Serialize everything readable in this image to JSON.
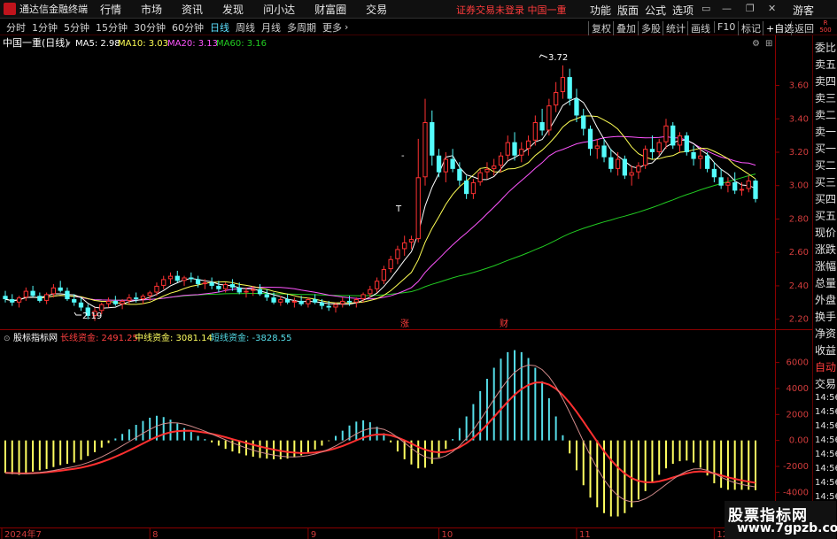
{
  "menubar": {
    "app_title": "通达信金融终端",
    "items": [
      "行情",
      "市场",
      "资讯",
      "发现",
      "问小达",
      "财富圈",
      "交易"
    ],
    "status": "证券交易未登录  中国一重",
    "right_items": [
      "功能",
      "版面",
      "公式",
      "选项"
    ],
    "guest": "游客"
  },
  "tabbar": {
    "tabs": [
      "分时",
      "1分钟",
      "5分钟",
      "15分钟",
      "30分钟",
      "60分钟",
      "日线",
      "周线",
      "月线",
      "多周期",
      "更多"
    ],
    "active": "日线",
    "right_tabs": [
      "复权",
      "叠加",
      "多股",
      "统计",
      "画线",
      "F10",
      "标记",
      "+自选",
      "返回"
    ]
  },
  "sidepanel": {
    "r_label": "R",
    "r_code": "500",
    "labels": [
      "委比",
      "卖五",
      "卖四",
      "卖三",
      "卖二",
      "卖一",
      "买一",
      "买二",
      "买三",
      "买四",
      "买五",
      "现价",
      "涨跌",
      "涨幅",
      "总量",
      "外盘",
      "换手",
      "净资",
      "收益"
    ],
    "auto": "自动",
    "trade": "交易",
    "times": [
      "14:56",
      "14:56",
      "14:56",
      "14:56",
      "14:56",
      "14:56",
      "14:56",
      "14:56"
    ]
  },
  "main_panel": {
    "title": "中国一重(日线)",
    "ma_legend": [
      {
        "label": "MA5: 2.98",
        "color": "#ffffff"
      },
      {
        "label": "MA10: 3.03",
        "color": "#ffff55"
      },
      {
        "label": "MA20: 3.13",
        "color": "#ff55ff"
      },
      {
        "label": "MA60: 3.16",
        "color": "#22cc22"
      }
    ],
    "high_label": "3.72",
    "low_label": "2.19",
    "t_mark": "T",
    "dash_mark": "-",
    "event_marks": [
      "涨",
      "财"
    ],
    "price_ticks": [
      "3.60",
      "3.40",
      "3.20",
      "3.00",
      "2.80",
      "2.60",
      "2.40",
      "2.20"
    ]
  },
  "indicator_panel": {
    "title": "股标指标网",
    "legend": [
      {
        "label": "长线资金: 2491.25",
        "color": "#ff4040"
      },
      {
        "label": "中线资金: 3081.14",
        "color": "#ffff60"
      },
      {
        "label": "短线资金: -3828.55",
        "color": "#55dde8"
      }
    ],
    "ticks": [
      "6000",
      "4000",
      "2000",
      "0.00",
      "-2000",
      "-4000"
    ]
  },
  "date_axis": [
    "2024年7",
    "8",
    "9",
    "10",
    "11",
    "12"
  ],
  "watermark": {
    "line1": "股票指标网",
    "line2": "www.7gpzb.com"
  },
  "colors": {
    "up": "#ff3232",
    "down": "#54fcfc",
    "ma5": "#ffffff",
    "ma10": "#ffff55",
    "ma20": "#ff55ff",
    "ma60": "#22cc22",
    "long_fund": "#ff3030",
    "mid_fund": "#ffff60",
    "short_fund": "#55dde8"
  },
  "chart_data": {
    "type": "candlestick",
    "title": "中国一重(日线)",
    "y_range": [
      2.14,
      3.82
    ],
    "indicator_range": [
      -6500,
      7200
    ],
    "candles": [
      [
        2.34,
        2.37,
        2.3,
        2.32
      ],
      [
        2.32,
        2.35,
        2.28,
        2.3
      ],
      [
        2.3,
        2.34,
        2.27,
        2.33
      ],
      [
        2.33,
        2.39,
        2.31,
        2.37
      ],
      [
        2.37,
        2.4,
        2.33,
        2.34
      ],
      [
        2.34,
        2.36,
        2.3,
        2.31
      ],
      [
        2.31,
        2.36,
        2.29,
        2.35
      ],
      [
        2.35,
        2.41,
        2.33,
        2.39
      ],
      [
        2.39,
        2.43,
        2.36,
        2.37
      ],
      [
        2.37,
        2.39,
        2.31,
        2.32
      ],
      [
        2.32,
        2.35,
        2.28,
        2.3
      ],
      [
        2.3,
        2.33,
        2.25,
        2.27
      ],
      [
        2.27,
        2.29,
        2.2,
        2.22
      ],
      [
        2.22,
        2.27,
        2.19,
        2.25
      ],
      [
        2.25,
        2.3,
        2.23,
        2.29
      ],
      [
        2.29,
        2.33,
        2.27,
        2.31
      ],
      [
        2.31,
        2.34,
        2.28,
        2.29
      ],
      [
        2.29,
        2.32,
        2.26,
        2.31
      ],
      [
        2.31,
        2.35,
        2.29,
        2.33
      ],
      [
        2.33,
        2.36,
        2.3,
        2.32
      ],
      [
        2.32,
        2.35,
        2.29,
        2.34
      ],
      [
        2.34,
        2.37,
        2.31,
        2.36
      ],
      [
        2.36,
        2.42,
        2.34,
        2.4
      ],
      [
        2.4,
        2.46,
        2.38,
        2.44
      ],
      [
        2.44,
        2.48,
        2.41,
        2.46
      ],
      [
        2.46,
        2.49,
        2.42,
        2.43
      ],
      [
        2.43,
        2.46,
        2.4,
        2.45
      ],
      [
        2.45,
        2.48,
        2.42,
        2.44
      ],
      [
        2.44,
        2.46,
        2.39,
        2.41
      ],
      [
        2.41,
        2.44,
        2.38,
        2.42
      ],
      [
        2.42,
        2.45,
        2.38,
        2.4
      ],
      [
        2.4,
        2.43,
        2.36,
        2.38
      ],
      [
        2.38,
        2.42,
        2.36,
        2.41
      ],
      [
        2.41,
        2.44,
        2.37,
        2.39
      ],
      [
        2.39,
        2.42,
        2.35,
        2.36
      ],
      [
        2.36,
        2.39,
        2.33,
        2.37
      ],
      [
        2.37,
        2.4,
        2.34,
        2.38
      ],
      [
        2.38,
        2.41,
        2.34,
        2.35
      ],
      [
        2.35,
        2.38,
        2.31,
        2.33
      ],
      [
        2.33,
        2.36,
        2.29,
        2.3
      ],
      [
        2.3,
        2.34,
        2.28,
        2.32
      ],
      [
        2.32,
        2.35,
        2.29,
        2.3
      ],
      [
        2.3,
        2.33,
        2.27,
        2.31
      ],
      [
        2.31,
        2.34,
        2.28,
        2.29
      ],
      [
        2.29,
        2.33,
        2.27,
        2.32
      ],
      [
        2.32,
        2.35,
        2.29,
        2.3
      ],
      [
        2.3,
        2.32,
        2.26,
        2.28
      ],
      [
        2.28,
        2.31,
        2.25,
        2.27
      ],
      [
        2.27,
        2.3,
        2.24,
        2.29
      ],
      [
        2.29,
        2.33,
        2.27,
        2.31
      ],
      [
        2.31,
        2.34,
        2.28,
        2.3
      ],
      [
        2.3,
        2.33,
        2.27,
        2.32
      ],
      [
        2.32,
        2.36,
        2.3,
        2.35
      ],
      [
        2.35,
        2.4,
        2.33,
        2.38
      ],
      [
        2.38,
        2.45,
        2.36,
        2.43
      ],
      [
        2.43,
        2.52,
        2.41,
        2.5
      ],
      [
        2.5,
        2.58,
        2.48,
        2.56
      ],
      [
        2.56,
        2.64,
        2.53,
        2.62
      ],
      [
        2.62,
        2.7,
        2.58,
        2.66
      ],
      [
        2.66,
        2.7,
        2.62,
        2.68
      ],
      [
        2.68,
        3.28,
        2.66,
        3.05
      ],
      [
        3.05,
        3.52,
        3.0,
        3.38
      ],
      [
        3.38,
        3.45,
        3.12,
        3.18
      ],
      [
        3.18,
        3.22,
        3.05,
        3.08
      ],
      [
        3.08,
        3.2,
        3.02,
        3.16
      ],
      [
        3.16,
        3.22,
        3.08,
        3.1
      ],
      [
        3.1,
        3.14,
        3.0,
        3.03
      ],
      [
        3.03,
        3.06,
        2.92,
        2.95
      ],
      [
        2.95,
        3.04,
        2.92,
        3.02
      ],
      [
        3.02,
        3.1,
        3.0,
        3.08
      ],
      [
        3.08,
        3.14,
        3.04,
        3.1
      ],
      [
        3.1,
        3.16,
        3.06,
        3.12
      ],
      [
        3.12,
        3.2,
        3.08,
        3.18
      ],
      [
        3.18,
        3.3,
        3.15,
        3.26
      ],
      [
        3.26,
        3.32,
        3.15,
        3.18
      ],
      [
        3.18,
        3.26,
        3.14,
        3.22
      ],
      [
        3.22,
        3.3,
        3.18,
        3.27
      ],
      [
        3.27,
        3.42,
        3.24,
        3.38
      ],
      [
        3.38,
        3.46,
        3.3,
        3.33
      ],
      [
        3.33,
        3.52,
        3.3,
        3.48
      ],
      [
        3.48,
        3.62,
        3.44,
        3.56
      ],
      [
        3.56,
        3.72,
        3.52,
        3.65
      ],
      [
        3.65,
        3.7,
        3.48,
        3.52
      ],
      [
        3.52,
        3.58,
        3.38,
        3.42
      ],
      [
        3.42,
        3.46,
        3.3,
        3.34
      ],
      [
        3.34,
        3.36,
        3.18,
        3.22
      ],
      [
        3.22,
        3.28,
        3.16,
        3.24
      ],
      [
        3.24,
        3.28,
        3.14,
        3.17
      ],
      [
        3.17,
        3.22,
        3.08,
        3.1
      ],
      [
        3.1,
        3.2,
        3.06,
        3.16
      ],
      [
        3.16,
        3.18,
        3.04,
        3.06
      ],
      [
        3.06,
        3.12,
        3.0,
        3.08
      ],
      [
        3.08,
        3.14,
        3.04,
        3.12
      ],
      [
        3.12,
        3.24,
        3.1,
        3.22
      ],
      [
        3.22,
        3.3,
        3.16,
        3.2
      ],
      [
        3.2,
        3.28,
        3.18,
        3.26
      ],
      [
        3.26,
        3.4,
        3.22,
        3.36
      ],
      [
        3.36,
        3.38,
        3.22,
        3.24
      ],
      [
        3.24,
        3.32,
        3.2,
        3.3
      ],
      [
        3.3,
        3.32,
        3.18,
        3.2
      ],
      [
        3.2,
        3.24,
        3.12,
        3.16
      ],
      [
        3.16,
        3.22,
        3.1,
        3.18
      ],
      [
        3.18,
        3.2,
        3.08,
        3.1
      ],
      [
        3.1,
        3.14,
        3.02,
        3.05
      ],
      [
        3.05,
        3.1,
        2.98,
        3.0
      ],
      [
        3.0,
        3.05,
        2.96,
        3.02
      ],
      [
        3.02,
        3.08,
        2.95,
        2.97
      ],
      [
        2.97,
        3.02,
        2.94,
        2.98
      ],
      [
        2.98,
        3.06,
        2.96,
        3.03
      ],
      [
        3.03,
        3.04,
        2.9,
        2.92
      ]
    ],
    "indicator": [
      -2500,
      -2600,
      -2650,
      -2600,
      -2400,
      -2300,
      -2200,
      -2050,
      -1900,
      -1800,
      -1700,
      -1500,
      -1200,
      -900,
      -550,
      -200,
      150,
      500,
      850,
      1200,
      1500,
      1750,
      1900,
      1800,
      1600,
      1300,
      950,
      650,
      350,
      100,
      -150,
      -400,
      -650,
      -850,
      -1000,
      -1150,
      -1250,
      -1350,
      -1400,
      -1450,
      -1450,
      -1400,
      -1300,
      -1150,
      -950,
      -700,
      -400,
      -50,
      350,
      750,
      1150,
      1450,
      1550,
      1400,
      1050,
      550,
      -150,
      -850,
      -1450,
      -1850,
      -2150,
      -2100,
      -1800,
      -1300,
      -650,
      100,
      950,
      1850,
      2800,
      3800,
      4750,
      5600,
      6300,
      6800,
      6950,
      6800,
      6350,
      5600,
      4550,
      3250,
      1850,
      400,
      -1000,
      -2300,
      -3450,
      -4400,
      -5150,
      -5600,
      -5850,
      -5850,
      -5600,
      -5150,
      -4550,
      -3900,
      -3250,
      -2650,
      -2150,
      -1800,
      -1600,
      -1550,
      -1700,
      -2100,
      -2700,
      -3300,
      -3650,
      -3800,
      -3800,
      -3800,
      -3800,
      -3830
    ]
  }
}
